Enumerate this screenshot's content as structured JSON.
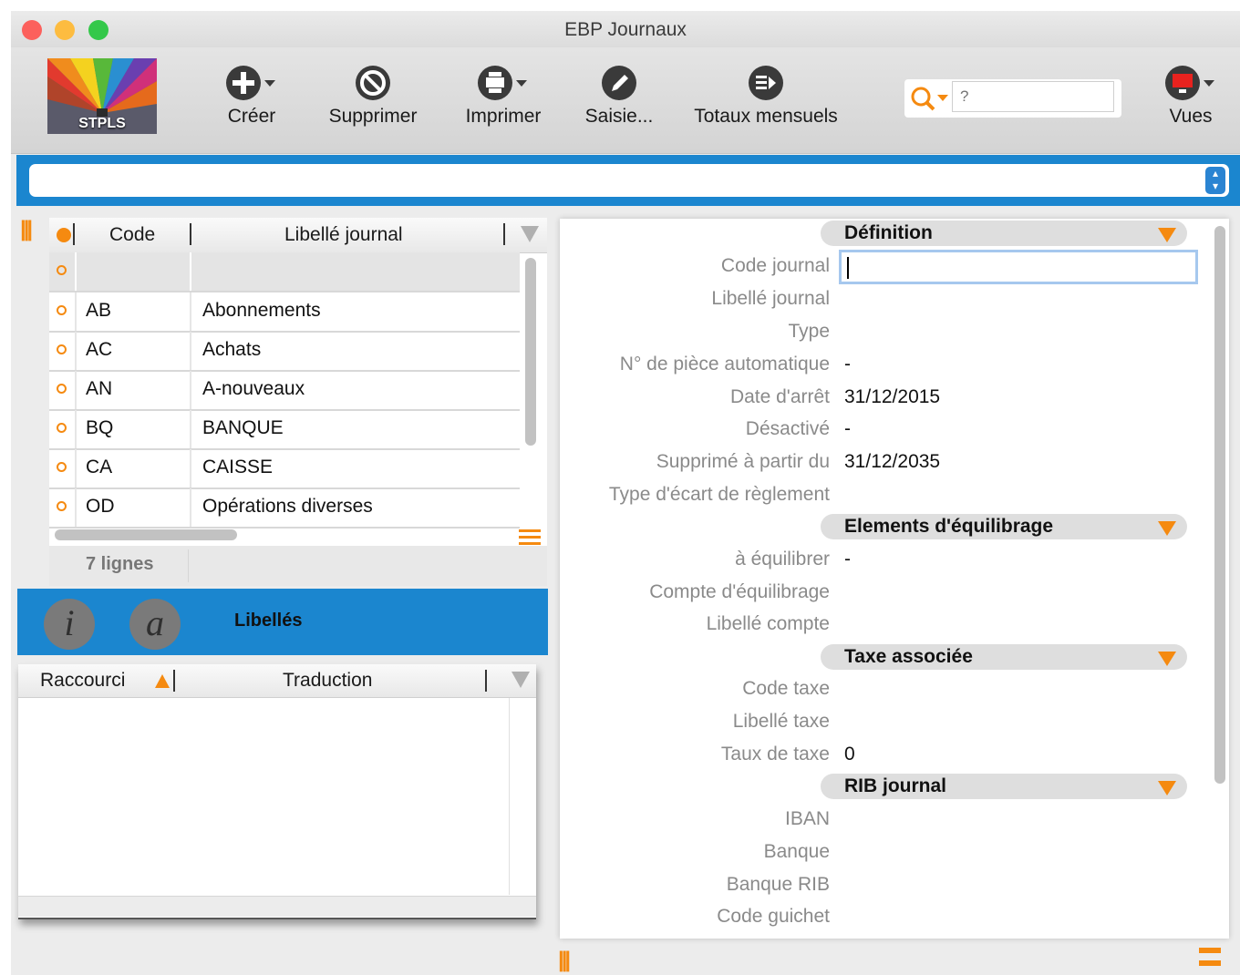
{
  "window": {
    "title": "EBP Journaux"
  },
  "logo": {
    "text": "STPLS"
  },
  "toolbar": {
    "creer": "Créer",
    "supprimer": "Supprimer",
    "imprimer": "Imprimer",
    "saisie": "Saisie...",
    "totaux": "Totaux mensuels",
    "vues": "Vues",
    "search_placeholder": "?"
  },
  "grid": {
    "columns": {
      "code": "Code",
      "libelle": "Libellé journal"
    },
    "rows": [
      {
        "code": "",
        "libelle": ""
      },
      {
        "code": "AB",
        "libelle": "Abonnements"
      },
      {
        "code": "AC",
        "libelle": "Achats"
      },
      {
        "code": "AN",
        "libelle": "A-nouveaux"
      },
      {
        "code": "BQ",
        "libelle": "BANQUE"
      },
      {
        "code": "CA",
        "libelle": "CAISSE"
      },
      {
        "code": "OD",
        "libelle": "Opérations diverses"
      }
    ],
    "count_label": "7 lignes"
  },
  "libelles": {
    "info_glyph": "i",
    "at_glyph": "a",
    "title": "Libellés",
    "columns": {
      "raccourci": "Raccourci",
      "traduction": "Traduction"
    }
  },
  "detail": {
    "sections": {
      "definition": "Définition",
      "equilibrage": "Elements d'équilibrage",
      "taxe": "Taxe associée",
      "rib": "RIB journal"
    },
    "fields": {
      "code_journal": {
        "label": "Code journal",
        "value": ""
      },
      "libelle_journal": {
        "label": "Libellé journal",
        "value": ""
      },
      "type": {
        "label": "Type",
        "value": ""
      },
      "piece_auto": {
        "label": "N° de pièce automatique",
        "value": "-"
      },
      "date_arret": {
        "label": "Date d'arrêt",
        "value": "31/12/2015"
      },
      "desactive": {
        "label": "Désactivé",
        "value": "-"
      },
      "supprime": {
        "label": "Supprimé à partir du",
        "value": "31/12/2035"
      },
      "type_ecart": {
        "label": "Type d'écart de règlement",
        "value": ""
      },
      "a_equilibrer": {
        "label": "à équilibrer",
        "value": "-"
      },
      "compte_equilibrage": {
        "label": "Compte d'équilibrage",
        "value": ""
      },
      "libelle_compte": {
        "label": "Libellé compte",
        "value": ""
      },
      "code_taxe": {
        "label": "Code taxe",
        "value": ""
      },
      "libelle_taxe": {
        "label": "Libellé taxe",
        "value": ""
      },
      "taux_taxe": {
        "label": "Taux de taxe",
        "value": "0"
      },
      "iban": {
        "label": "IBAN",
        "value": ""
      },
      "banque": {
        "label": "Banque",
        "value": ""
      },
      "banque_rib": {
        "label": "Banque RIB",
        "value": ""
      },
      "code_guichet": {
        "label": "Code guichet",
        "value": ""
      }
    }
  },
  "colors": {
    "accent_orange": "#f58a10",
    "blue_band": "#1b86cf",
    "close": "#fc605c",
    "minimize": "#fdbc40",
    "zoom": "#34c84a"
  }
}
